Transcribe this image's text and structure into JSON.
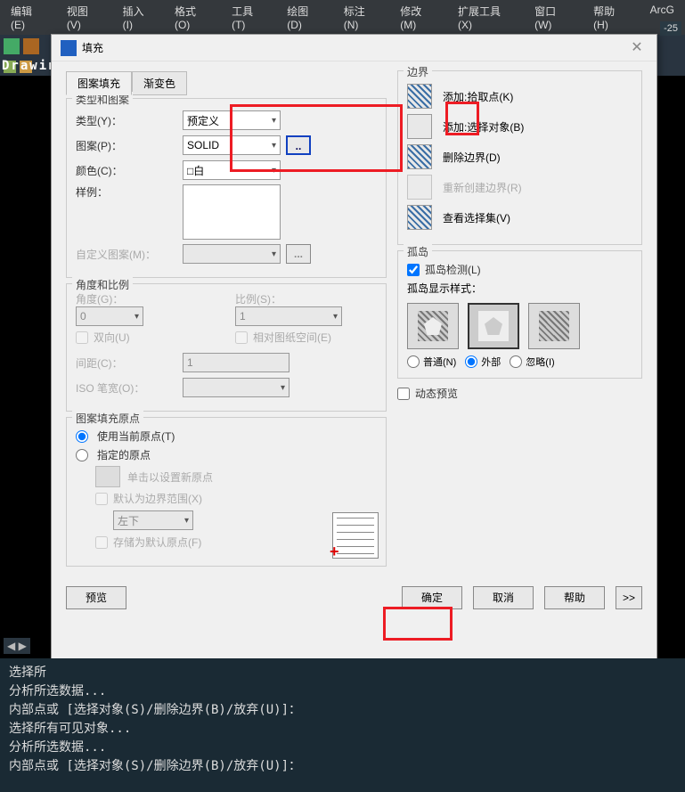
{
  "menubar": {
    "items": [
      "编辑(E)",
      "视图(V)",
      "插入(I)",
      "格式(O)",
      "工具(T)",
      "绘图(D)",
      "标注(N)",
      "修改(M)",
      "扩展工具(X)",
      "窗口(W)",
      "帮助(H)",
      "ArcG"
    ]
  },
  "right_label": "-25",
  "drawing_label": "Drawin",
  "dialog": {
    "title": "填充",
    "tabs": [
      "图案填充",
      "渐变色"
    ],
    "group_type_pattern": {
      "legend": "类型和图案",
      "type_label": "类型(Y)：",
      "type_value": "预定义",
      "pattern_label": "图案(P)：",
      "pattern_value": "SOLID",
      "pattern_browse": "..",
      "color_label": "颜色(C)：",
      "color_value": "□白",
      "sample_label": "样例：",
      "custom_label": "自定义图案(M)：",
      "custom_browse": "..."
    },
    "group_angle_scale": {
      "legend": "角度和比例",
      "angle_label": "角度(G)：",
      "angle_value": "0",
      "scale_label": "比例(S)：",
      "scale_value": "1",
      "bidir": "双向(U)",
      "paperspace": "相对图纸空间(E)",
      "spacing_label": "间距(C)：",
      "spacing_value": "1",
      "iso_label": "ISO 笔宽(O)："
    },
    "group_origin": {
      "legend": "图案填充原点",
      "use_current": "使用当前原点(T)",
      "specified": "指定的原点",
      "click_set": "单击以设置新原点",
      "set_btn_icon": "",
      "default_extent": "默认为边界范围(X)",
      "position_value": "左下",
      "store_default": "存储为默认原点(F)"
    },
    "group_boundary": {
      "legend": "边界",
      "add_pick": "添加:拾取点(K)",
      "add_select": "添加:选择对象(B)",
      "remove": "删除边界(D)",
      "recreate": "重新创建边界(R)",
      "view_sel": "查看选择集(V)"
    },
    "group_island": {
      "legend": "孤岛",
      "detect": "孤岛检测(L)",
      "style_label": "孤岛显示样式：",
      "normal": "普通(N)",
      "outer": "外部",
      "ignore": "忽略(I)"
    },
    "dynamic_preview": "动态预览",
    "buttons": {
      "preview": "预览",
      "ok": "确定",
      "cancel": "取消",
      "help": "帮助",
      "expand": ">>"
    }
  },
  "console": {
    "lines": [
      "选择所",
      "分析所选数据...",
      "内部点或 [选择对象(S)/删除边界(B)/放弃(U)]：",
      "选择所有可见对象...",
      "分析所选数据...",
      "内部点或 [选择对象(S)/删除边界(B)/放弃(U)]："
    ]
  }
}
